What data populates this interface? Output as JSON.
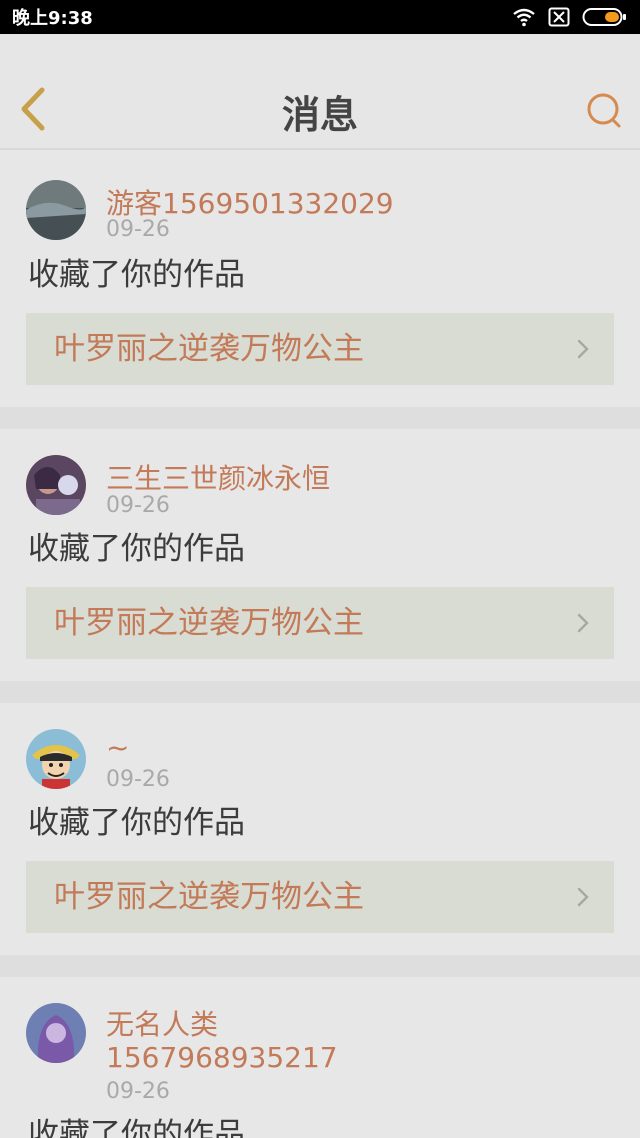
{
  "status_bar": {
    "time": "晚上9:38"
  },
  "header": {
    "title": "消息"
  },
  "action_text": "收藏了你的作品",
  "items": [
    {
      "username": "游客1569501332029",
      "date": "09-26",
      "action": "收藏了你的作品",
      "work_title": "叶罗丽之逆袭万物公主"
    },
    {
      "username": "三生三世颜冰永恒",
      "date": "09-26",
      "action": "收藏了你的作品",
      "work_title": "叶罗丽之逆袭万物公主"
    },
    {
      "username": "~",
      "date": "09-26",
      "action": "收藏了你的作品",
      "work_title": "叶罗丽之逆袭万物公主"
    },
    {
      "username_line1": "无名人类",
      "username_line2": "1567968935217",
      "date": "09-26",
      "action": "收藏了你的作品"
    }
  ],
  "colors": {
    "accent": "#c27a58",
    "background": "#e6e6e6",
    "work_row": "#d9dcd3"
  }
}
